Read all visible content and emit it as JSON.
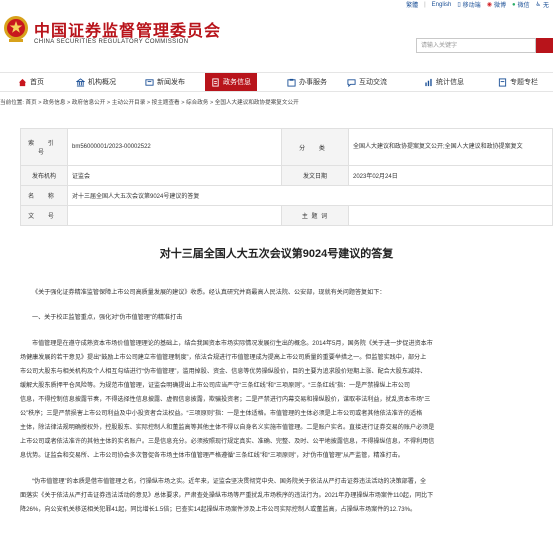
{
  "top": {
    "links": [
      "繁體",
      "English"
    ],
    "right_links": [
      "移动端",
      "微博",
      "微信",
      "无"
    ]
  },
  "brand": {
    "cn_title": "中国证券监督管理委员会",
    "en_title": "CHINA SECURITIES REGULATORY COMMISSION"
  },
  "search": {
    "placeholder": "请输入关键字"
  },
  "nav": {
    "items": [
      {
        "label": "首页",
        "icon": "home-icon"
      },
      {
        "label": "机构概况",
        "icon": "building-icon"
      },
      {
        "label": "新闻发布",
        "icon": "news-icon"
      },
      {
        "label": "政务信息",
        "icon": "document-icon",
        "active": true
      },
      {
        "label": "办事服务",
        "icon": "service-icon"
      },
      {
        "label": "互动交流",
        "icon": "chat-icon"
      },
      {
        "label": "统计信息",
        "icon": "stats-icon"
      },
      {
        "label": "专题专栏",
        "icon": "topic-icon"
      }
    ],
    "active_color": "#b8141b"
  },
  "breadcrumb": "当前位置: 首页 > 政务信息 > 政府信息公开 > 主动公开目录 > 按主题查看 > 综合政务 > 全国人大建议和政协提案复文公开",
  "meta": {
    "index_label": "索 引 号",
    "index_value": "bm56000001/2023-00002522",
    "category_label": "分 类",
    "category_value": "全国人大建议和政协提案复文公开;全国人大建议和政协提案复文",
    "agency_label": "发布机构",
    "agency_value": "证监会",
    "date_label": "发文日期",
    "date_value": "2023年02月24日",
    "name_label": "名 称",
    "name_value": "对十三届全国人大五次会议第9024号建议的答复",
    "number_label": "文 号",
    "number_value": "",
    "keywords_label": "主 题 词",
    "keywords_value": ""
  },
  "doc_title": "对十三届全国人大五次会议第9024号建议的答复",
  "paragraphs": [
    "《关于强化证券精准监管保障上市公司高质量发展的建议》收悉。经认真研究并商最高人民法院、公安部，现就有关问题答复如下：",
    "一、关于校正监管重点，强化对“伪市值管理”的精准打击",
    "市值管理是在遵守成熟资本市场价值管理理论的基础上，结合我国资本市场实际情况发展衍生出的概念。2014年5月，国务院《关于进一步促进资本市",
    "场健康发展的若干意见》提出“鼓励上市公司建立市值管理制度”，依法合规进行市值管理成为提高上市公司质量的重要举措之一。但监管实践中，部分上",
    "市公司大股东与相关机构及个人相互勾结进行“伪市值管理”，滥用掉股、资金、信息等优势操纵股价，目的主要为追求股价短期上涨、配合大股东减持、",
    "缓解大股东质押平仓风险等。为规范市值管理，证监会明确提出上市公司应当严守“三条红线”和“三项原则”。“三条红线”指：一是严禁操纵上市公司",
    "信息，不得控制信息披露节奏，不得选择性信息披露、虚假信息披露，欺骗投资者；二是严禁进行内幕交易和操纵股价，谋取非法利益，扰乱资本市场“三",
    "公”秩序；三是严禁损害上市公司利益及中小投资者合法权益。“三项原则”指：一是主体适格。市值管理的主体必须是上市公司或者其他依法准许的适格",
    "主体，除法律法规明确授权外，控股股东、实际控制人和董监高等其他主体不得以自身名义实施市值管理。二是账户实名。直接进行证券交易的账户必须是",
    "上市公司或者依法准许的其他主体的实名账户。三是信息充分。必须按照现行规定真实、准确、完整、及时、公平地披露信息，不得操纵信息，不得利用信",
    "息优势。证监会和交易所、上市公司协会多次督促各市场主体市值管理严格遵循“三条红线”和“三项原则”，对“伪市值管理”从严监管，精准打击。",
    "“伪市值管理”的本质是借市值管理之名，行操纵市场之实。近年来，证监会坚决贯彻党中央、国务院关于依法从严打击证券违法活动的决策部署，全",
    "面落实《关于依法从严打击证券违法活动的意见》总体要求，严肃查处操纵市场等严重扰乱市场秩序的违法行为。2021年办理操纵市场案件110起，同比下",
    "降26%，向公安机关移送相关犯罪41起，同比增长1.5倍；已查实14起操纵市场案件涉及上市公司实际控制人或董监高，占操纵市场案件的12.73%。"
  ]
}
